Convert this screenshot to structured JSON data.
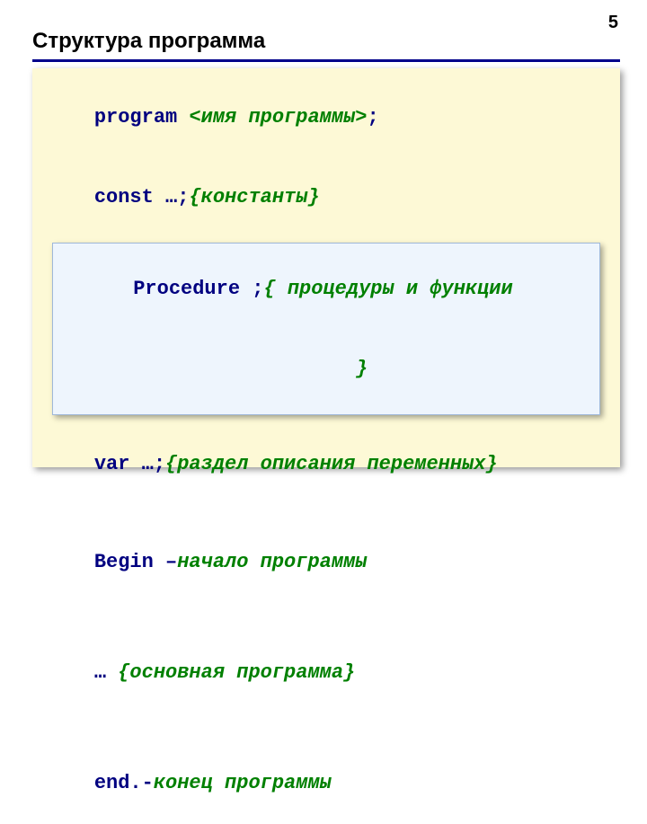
{
  "page_number": "5",
  "title": "Структура программа",
  "code": {
    "l1_kw": "program",
    "l1_ph": "<имя программы>",
    "l1_semi": ";",
    "l2_kw": "const …;",
    "l2_cm": "{константы}",
    "proc_kw": "Procedure ;",
    "proc_cm1": "{ процедуры и функции",
    "proc_cm2": "}",
    "l4_kw": "var …;",
    "l4_cm": "{раздел описания переменных}",
    "l5_kw": "Begin –",
    "l5_cm": "начало программы",
    "l6_pre": "… ",
    "l6_cm": "{основная программа}",
    "l7_kw": "end.-",
    "l7_cm": "конец программы"
  }
}
